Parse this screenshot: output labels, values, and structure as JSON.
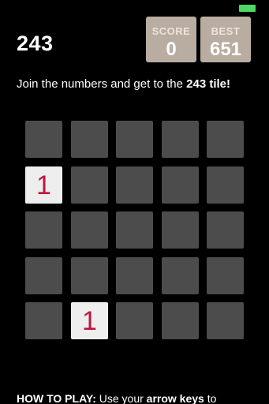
{
  "title": "243",
  "score": {
    "label": "SCORE",
    "value": "0"
  },
  "best": {
    "label": "BEST",
    "value": "651"
  },
  "intro": {
    "prefix": "Join the numbers and get to the ",
    "target": "243 tile!"
  },
  "board": {
    "rows": 5,
    "cols": 5,
    "tiles": [
      {
        "row": 1,
        "col": 0,
        "value": "1"
      },
      {
        "row": 4,
        "col": 1,
        "value": "1"
      }
    ]
  },
  "howto": {
    "heading": "HOW TO PLAY:",
    "text": " Use your ",
    "keys": "arrow keys",
    "suffix": " to"
  },
  "colors": {
    "background": "#000000",
    "cell_empty": "#4c4c4c",
    "tile_bg": "#eeeeee",
    "tile_text": "#c0143c",
    "score_box": "#b9ada1",
    "score_label": "#eee4da",
    "battery": "#4cd964"
  }
}
